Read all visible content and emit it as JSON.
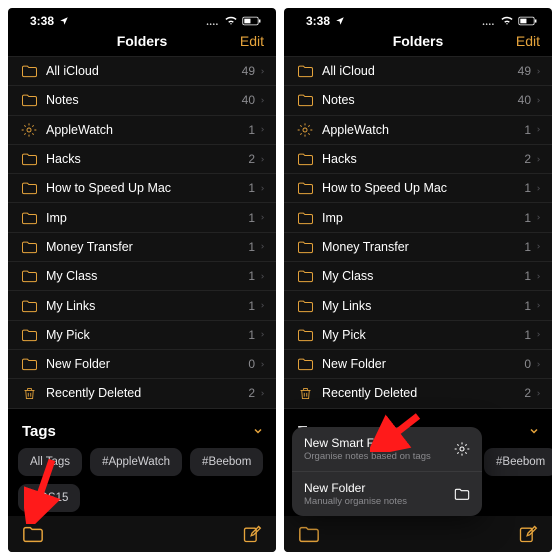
{
  "status": {
    "time": "3:38",
    "loc_icon": "location-icon"
  },
  "header": {
    "title": "Folders",
    "edit": "Edit"
  },
  "folders": [
    {
      "icon": "folder",
      "label": "All iCloud",
      "count": 49
    },
    {
      "icon": "folder",
      "label": "Notes",
      "count": 40
    },
    {
      "icon": "gear",
      "label": "AppleWatch",
      "count": 1
    },
    {
      "icon": "folder",
      "label": "Hacks",
      "count": 2
    },
    {
      "icon": "folder",
      "label": "How to Speed Up Mac",
      "count": 1
    },
    {
      "icon": "folder",
      "label": "Imp",
      "count": 1
    },
    {
      "icon": "folder",
      "label": "Money Transfer",
      "count": 1
    },
    {
      "icon": "folder",
      "label": "My Class",
      "count": 1
    },
    {
      "icon": "folder",
      "label": "My Links",
      "count": 1
    },
    {
      "icon": "folder",
      "label": "My Pick",
      "count": 1
    },
    {
      "icon": "folder",
      "label": "New Folder",
      "count": 0
    },
    {
      "icon": "trash",
      "label": "Recently Deleted",
      "count": 2
    }
  ],
  "tags_section": {
    "title": "Tags"
  },
  "tags": [
    "All Tags",
    "#AppleWatch",
    "#Beebom",
    "#iOS15"
  ],
  "menu": {
    "smart": {
      "title": "New Smart Folder",
      "sub": "Organise notes based on tags"
    },
    "plain": {
      "title": "New Folder",
      "sub": "Manually organise notes"
    }
  }
}
